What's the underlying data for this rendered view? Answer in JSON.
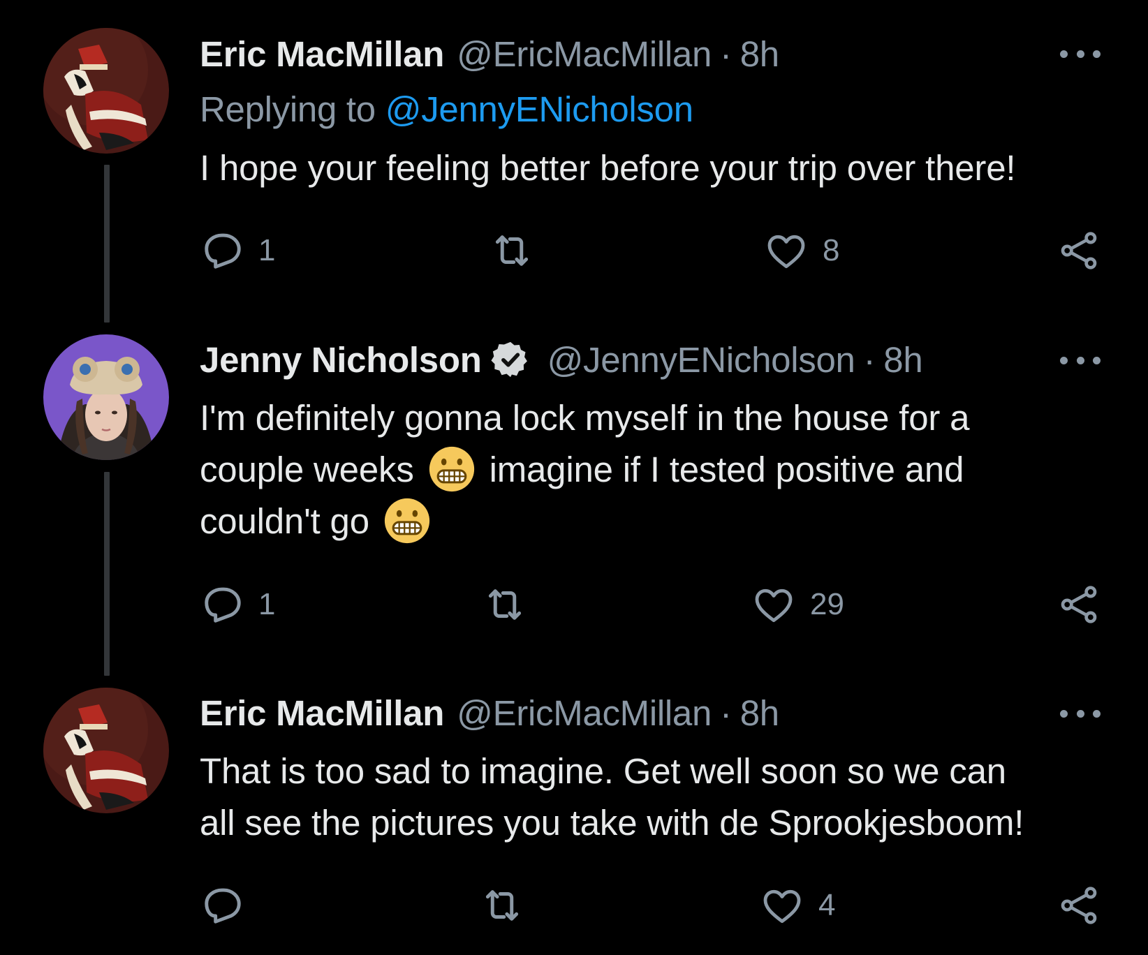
{
  "tweets": [
    {
      "name": "Eric MacMillan",
      "handle": "@EricMacMillan",
      "separator": "·",
      "time": "8h",
      "verified": false,
      "replying_label": "Replying to",
      "replying_handle": "@JennyENicholson",
      "text_lines": [
        "I hope your feeling better before your trip over there!"
      ],
      "actions": {
        "reply_count": "1",
        "retweet_count": "",
        "like_count": "8"
      }
    },
    {
      "name": "Jenny Nicholson",
      "handle": "@JennyENicholson",
      "separator": "·",
      "time": "8h",
      "verified": true,
      "text_parts": {
        "line1": "I'm definitely gonna lock myself in the house for a",
        "line2a": "couple weeks",
        "line2b": "imagine if I tested positive and",
        "line3": "couldn't go"
      },
      "emoji": "grimacing-face",
      "actions": {
        "reply_count": "1",
        "retweet_count": "",
        "like_count": "29"
      }
    },
    {
      "name": "Eric MacMillan",
      "handle": "@EricMacMillan",
      "separator": "·",
      "time": "8h",
      "verified": false,
      "text_lines": [
        "That is too sad to imagine. Get well soon so we can",
        "all see the pictures you take with de Sprookjesboom!"
      ],
      "actions": {
        "reply_count": "",
        "retweet_count": "",
        "like_count": "4"
      }
    }
  ],
  "colors": {
    "background": "#000000",
    "primary_text": "#e7e9ea",
    "secondary_text": "#8b98a5",
    "link": "#1d9bf0",
    "thread_line": "#333639"
  },
  "icons": [
    "reply-icon",
    "retweet-icon",
    "like-icon",
    "share-icon",
    "more-icon",
    "verified-badge-icon"
  ]
}
